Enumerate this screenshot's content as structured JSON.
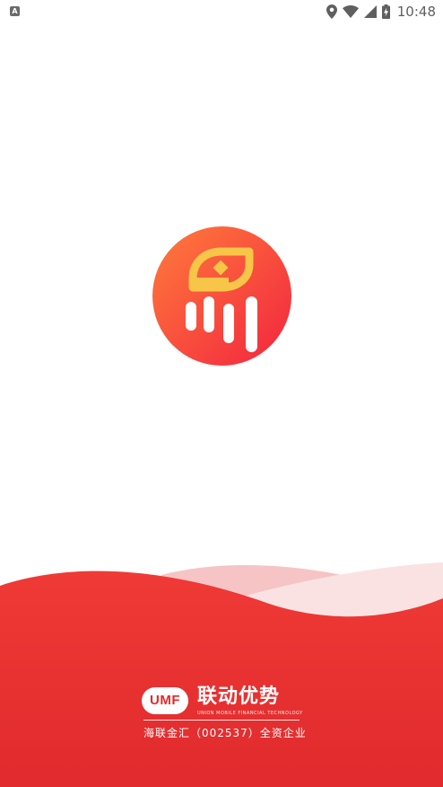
{
  "status_bar": {
    "time": "10:48",
    "notification_icon_letter": "A",
    "icons": [
      "location-icon",
      "wifi-icon",
      "signal-icon",
      "battery-charging-icon"
    ]
  },
  "brand": {
    "logo_mark": "coin-bars-logo",
    "umf_badge": "UMF",
    "name": "联动优势",
    "english_name": "UNION MOBILE FINANCIAL TECHNOLOGY",
    "subtitle": "海联金汇（002537）全资企业"
  },
  "colors": {
    "accent_red": "#e42a2b",
    "logo_gradient_start": "#ff7a3d",
    "logo_gradient_end": "#f22a45",
    "logo_gold": "#f7c548"
  }
}
